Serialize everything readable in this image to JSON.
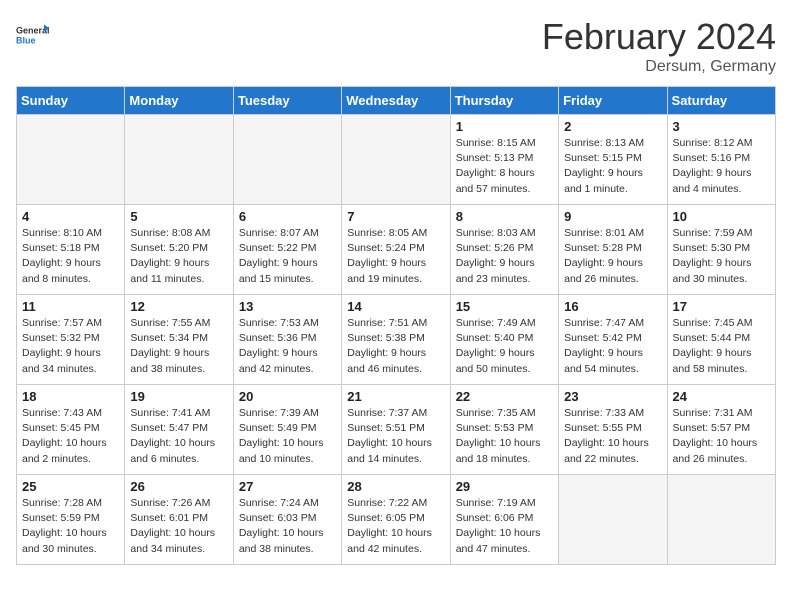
{
  "header": {
    "logo_general": "General",
    "logo_blue": "Blue",
    "month": "February 2024",
    "location": "Dersum, Germany"
  },
  "days_of_week": [
    "Sunday",
    "Monday",
    "Tuesday",
    "Wednesday",
    "Thursday",
    "Friday",
    "Saturday"
  ],
  "weeks": [
    [
      {
        "day": "",
        "empty": true
      },
      {
        "day": "",
        "empty": true
      },
      {
        "day": "",
        "empty": true
      },
      {
        "day": "",
        "empty": true
      },
      {
        "day": "1",
        "sunrise": "Sunrise: 8:15 AM",
        "sunset": "Sunset: 5:13 PM",
        "daylight": "Daylight: 8 hours and 57 minutes."
      },
      {
        "day": "2",
        "sunrise": "Sunrise: 8:13 AM",
        "sunset": "Sunset: 5:15 PM",
        "daylight": "Daylight: 9 hours and 1 minute."
      },
      {
        "day": "3",
        "sunrise": "Sunrise: 8:12 AM",
        "sunset": "Sunset: 5:16 PM",
        "daylight": "Daylight: 9 hours and 4 minutes."
      }
    ],
    [
      {
        "day": "4",
        "sunrise": "Sunrise: 8:10 AM",
        "sunset": "Sunset: 5:18 PM",
        "daylight": "Daylight: 9 hours and 8 minutes."
      },
      {
        "day": "5",
        "sunrise": "Sunrise: 8:08 AM",
        "sunset": "Sunset: 5:20 PM",
        "daylight": "Daylight: 9 hours and 11 minutes."
      },
      {
        "day": "6",
        "sunrise": "Sunrise: 8:07 AM",
        "sunset": "Sunset: 5:22 PM",
        "daylight": "Daylight: 9 hours and 15 minutes."
      },
      {
        "day": "7",
        "sunrise": "Sunrise: 8:05 AM",
        "sunset": "Sunset: 5:24 PM",
        "daylight": "Daylight: 9 hours and 19 minutes."
      },
      {
        "day": "8",
        "sunrise": "Sunrise: 8:03 AM",
        "sunset": "Sunset: 5:26 PM",
        "daylight": "Daylight: 9 hours and 23 minutes."
      },
      {
        "day": "9",
        "sunrise": "Sunrise: 8:01 AM",
        "sunset": "Sunset: 5:28 PM",
        "daylight": "Daylight: 9 hours and 26 minutes."
      },
      {
        "day": "10",
        "sunrise": "Sunrise: 7:59 AM",
        "sunset": "Sunset: 5:30 PM",
        "daylight": "Daylight: 9 hours and 30 minutes."
      }
    ],
    [
      {
        "day": "11",
        "sunrise": "Sunrise: 7:57 AM",
        "sunset": "Sunset: 5:32 PM",
        "daylight": "Daylight: 9 hours and 34 minutes."
      },
      {
        "day": "12",
        "sunrise": "Sunrise: 7:55 AM",
        "sunset": "Sunset: 5:34 PM",
        "daylight": "Daylight: 9 hours and 38 minutes."
      },
      {
        "day": "13",
        "sunrise": "Sunrise: 7:53 AM",
        "sunset": "Sunset: 5:36 PM",
        "daylight": "Daylight: 9 hours and 42 minutes."
      },
      {
        "day": "14",
        "sunrise": "Sunrise: 7:51 AM",
        "sunset": "Sunset: 5:38 PM",
        "daylight": "Daylight: 9 hours and 46 minutes."
      },
      {
        "day": "15",
        "sunrise": "Sunrise: 7:49 AM",
        "sunset": "Sunset: 5:40 PM",
        "daylight": "Daylight: 9 hours and 50 minutes."
      },
      {
        "day": "16",
        "sunrise": "Sunrise: 7:47 AM",
        "sunset": "Sunset: 5:42 PM",
        "daylight": "Daylight: 9 hours and 54 minutes."
      },
      {
        "day": "17",
        "sunrise": "Sunrise: 7:45 AM",
        "sunset": "Sunset: 5:44 PM",
        "daylight": "Daylight: 9 hours and 58 minutes."
      }
    ],
    [
      {
        "day": "18",
        "sunrise": "Sunrise: 7:43 AM",
        "sunset": "Sunset: 5:45 PM",
        "daylight": "Daylight: 10 hours and 2 minutes."
      },
      {
        "day": "19",
        "sunrise": "Sunrise: 7:41 AM",
        "sunset": "Sunset: 5:47 PM",
        "daylight": "Daylight: 10 hours and 6 minutes."
      },
      {
        "day": "20",
        "sunrise": "Sunrise: 7:39 AM",
        "sunset": "Sunset: 5:49 PM",
        "daylight": "Daylight: 10 hours and 10 minutes."
      },
      {
        "day": "21",
        "sunrise": "Sunrise: 7:37 AM",
        "sunset": "Sunset: 5:51 PM",
        "daylight": "Daylight: 10 hours and 14 minutes."
      },
      {
        "day": "22",
        "sunrise": "Sunrise: 7:35 AM",
        "sunset": "Sunset: 5:53 PM",
        "daylight": "Daylight: 10 hours and 18 minutes."
      },
      {
        "day": "23",
        "sunrise": "Sunrise: 7:33 AM",
        "sunset": "Sunset: 5:55 PM",
        "daylight": "Daylight: 10 hours and 22 minutes."
      },
      {
        "day": "24",
        "sunrise": "Sunrise: 7:31 AM",
        "sunset": "Sunset: 5:57 PM",
        "daylight": "Daylight: 10 hours and 26 minutes."
      }
    ],
    [
      {
        "day": "25",
        "sunrise": "Sunrise: 7:28 AM",
        "sunset": "Sunset: 5:59 PM",
        "daylight": "Daylight: 10 hours and 30 minutes."
      },
      {
        "day": "26",
        "sunrise": "Sunrise: 7:26 AM",
        "sunset": "Sunset: 6:01 PM",
        "daylight": "Daylight: 10 hours and 34 minutes."
      },
      {
        "day": "27",
        "sunrise": "Sunrise: 7:24 AM",
        "sunset": "Sunset: 6:03 PM",
        "daylight": "Daylight: 10 hours and 38 minutes."
      },
      {
        "day": "28",
        "sunrise": "Sunrise: 7:22 AM",
        "sunset": "Sunset: 6:05 PM",
        "daylight": "Daylight: 10 hours and 42 minutes."
      },
      {
        "day": "29",
        "sunrise": "Sunrise: 7:19 AM",
        "sunset": "Sunset: 6:06 PM",
        "daylight": "Daylight: 10 hours and 47 minutes."
      },
      {
        "day": "",
        "empty": true
      },
      {
        "day": "",
        "empty": true
      }
    ]
  ]
}
